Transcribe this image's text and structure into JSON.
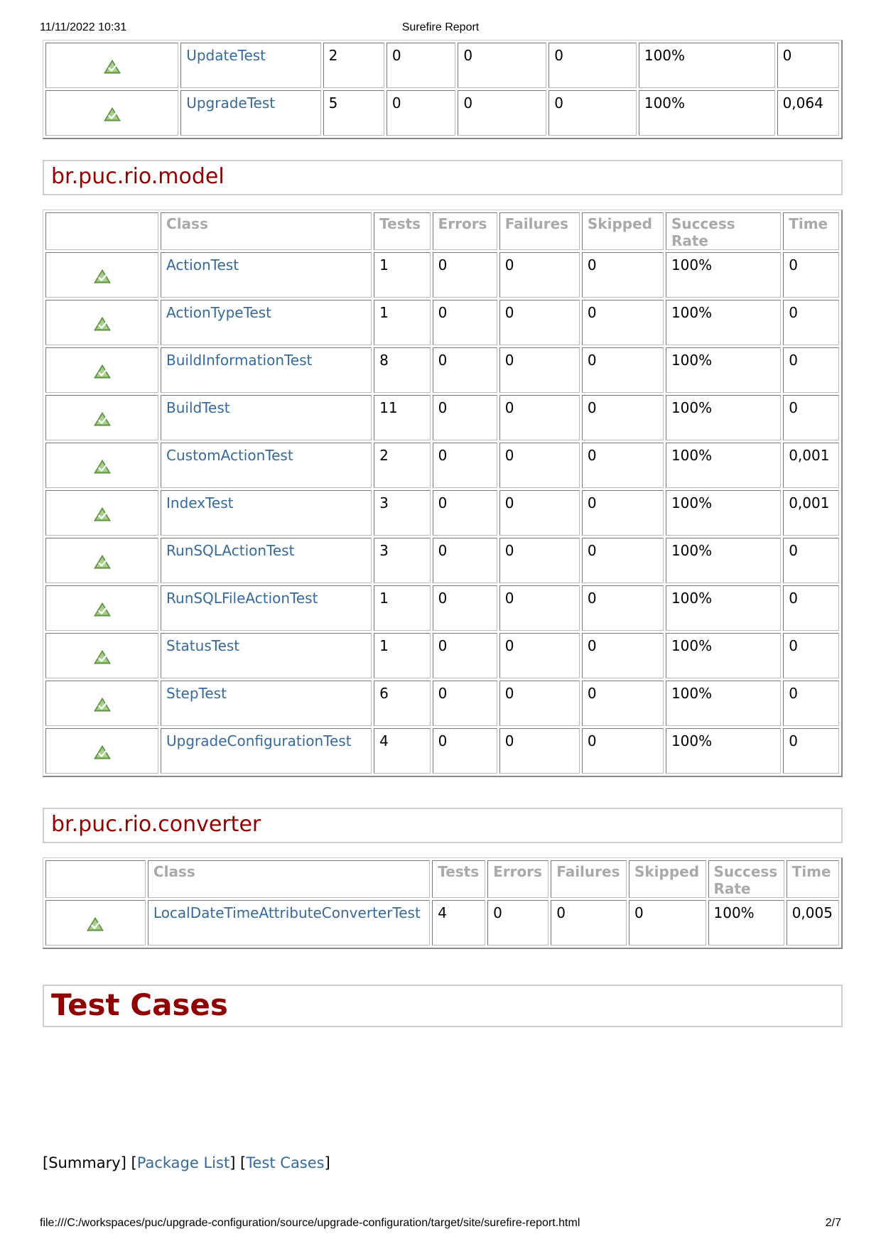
{
  "print_header": {
    "datetime": "11/11/2022 10:31",
    "title": "Surefire Report"
  },
  "print_footer": {
    "url": "file:///C:/workspaces/puc/upgrade-configuration/source/upgrade-configuration/target/site/surefire-report.html",
    "page": "2/7"
  },
  "columns": [
    "Class",
    "Tests",
    "Errors",
    "Failures",
    "Skipped",
    "Success Rate",
    "Time"
  ],
  "top_rows": [
    {
      "class": "UpdateTest",
      "tests": "2",
      "errors": "0",
      "failures": "0",
      "skipped": "0",
      "rate": "100%",
      "time": "0"
    },
    {
      "class": "UpgradeTest",
      "tests": "5",
      "errors": "0",
      "failures": "0",
      "skipped": "0",
      "rate": "100%",
      "time": "0,064"
    }
  ],
  "model": {
    "package": "br.puc.rio.model",
    "rows": [
      {
        "class": "ActionTest",
        "tests": "1",
        "errors": "0",
        "failures": "0",
        "skipped": "0",
        "rate": "100%",
        "time": "0"
      },
      {
        "class": "ActionTypeTest",
        "tests": "1",
        "errors": "0",
        "failures": "0",
        "skipped": "0",
        "rate": "100%",
        "time": "0"
      },
      {
        "class": "BuildInformationTest",
        "tests": "8",
        "errors": "0",
        "failures": "0",
        "skipped": "0",
        "rate": "100%",
        "time": "0"
      },
      {
        "class": "BuildTest",
        "tests": "11",
        "errors": "0",
        "failures": "0",
        "skipped": "0",
        "rate": "100%",
        "time": "0"
      },
      {
        "class": "CustomActionTest",
        "tests": "2",
        "errors": "0",
        "failures": "0",
        "skipped": "0",
        "rate": "100%",
        "time": "0,001"
      },
      {
        "class": "IndexTest",
        "tests": "3",
        "errors": "0",
        "failures": "0",
        "skipped": "0",
        "rate": "100%",
        "time": "0,001"
      },
      {
        "class": "RunSQLActionTest",
        "tests": "3",
        "errors": "0",
        "failures": "0",
        "skipped": "0",
        "rate": "100%",
        "time": "0"
      },
      {
        "class": "RunSQLFileActionTest",
        "tests": "1",
        "errors": "0",
        "failures": "0",
        "skipped": "0",
        "rate": "100%",
        "time": "0"
      },
      {
        "class": "StatusTest",
        "tests": "1",
        "errors": "0",
        "failures": "0",
        "skipped": "0",
        "rate": "100%",
        "time": "0"
      },
      {
        "class": "StepTest",
        "tests": "6",
        "errors": "0",
        "failures": "0",
        "skipped": "0",
        "rate": "100%",
        "time": "0"
      },
      {
        "class": "UpgradeConfigurationTest",
        "tests": "4",
        "errors": "0",
        "failures": "0",
        "skipped": "0",
        "rate": "100%",
        "time": "0"
      }
    ]
  },
  "converter": {
    "package": "br.puc.rio.converter",
    "rows": [
      {
        "class": "LocalDateTimeAttributeConverterTest",
        "tests": "4",
        "errors": "0",
        "failures": "0",
        "skipped": "0",
        "rate": "100%",
        "time": "0,005"
      }
    ]
  },
  "test_cases": {
    "title": "Test Cases"
  },
  "nav": {
    "summary": "Summary",
    "package_list": "Package List",
    "test_cases": "Test Cases"
  },
  "icons": {
    "status": "success-icon"
  }
}
